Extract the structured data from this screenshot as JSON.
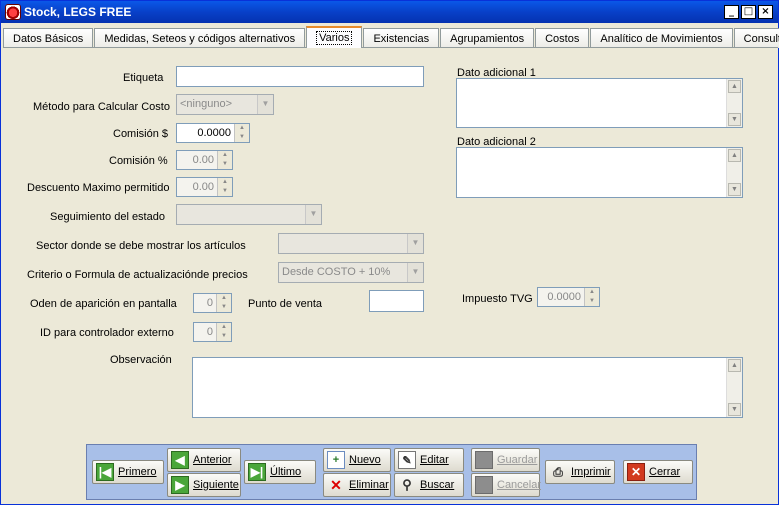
{
  "window": {
    "title": "Stock, LEGS FREE",
    "controls": {
      "minimize": "_",
      "maximize": "□",
      "close": "×"
    }
  },
  "tabs": [
    {
      "label": "Datos Básicos"
    },
    {
      "label": "Medidas, Seteos y códigos alternativos"
    },
    {
      "label": "Varios",
      "active": true
    },
    {
      "label": "Existencias"
    },
    {
      "label": "Agrupamientos"
    },
    {
      "label": "Costos"
    },
    {
      "label": "Analítico de Movimientos"
    },
    {
      "label": "Consultas"
    }
  ],
  "form": {
    "etiqueta": {
      "label": "Etiqueta",
      "value": ""
    },
    "metodo_costo": {
      "label": "Método para Calcular Costo",
      "value": "<ninguno>"
    },
    "comision_monto": {
      "label": "Comisión $",
      "value": "0.0000"
    },
    "comision_pct": {
      "label": "Comisión %",
      "value": "0.00"
    },
    "descuento_max": {
      "label": "Descuento Maximo permitido",
      "value": "0.00"
    },
    "seguimiento_estado": {
      "label": "Seguimiento del estado",
      "value": ""
    },
    "sector": {
      "label": "Sector donde se debe mostrar los artículos",
      "value": ""
    },
    "criterio": {
      "label": "Criterio o Formula de actualizaciónde precios",
      "value": "Desde COSTO + 10%"
    },
    "orden_aparicion": {
      "label": "Oden de aparición en pantalla",
      "value": "0"
    },
    "punto_venta": {
      "label": "Punto de venta",
      "value": ""
    },
    "id_controlador": {
      "label": "ID para controlador externo",
      "value": "0"
    },
    "observacion": {
      "label": "Observación",
      "value": ""
    },
    "dato_adicional_1": {
      "label": "Dato adicional 1",
      "value": ""
    },
    "dato_adicional_2": {
      "label": "Dato adicional 2",
      "value": ""
    },
    "impuesto_tvg": {
      "label": "Impuesto TVG",
      "value": "0.0000"
    }
  },
  "toolbar": {
    "primero": "Primero",
    "anterior": "Anterior",
    "siguiente": "Siguiente",
    "ultimo": "Último",
    "nuevo": "Nuevo",
    "eliminar": "Eliminar",
    "editar": "Editar",
    "buscar": "Buscar",
    "guardar": "Guardar",
    "cancelar": "Cancelar",
    "imprimir": "Imprimir",
    "cerrar": "Cerrar"
  },
  "colors": {
    "titlebar": "#0a58e8",
    "active_tab_accent": "#e68b2c",
    "navbar": "#a8bfe8",
    "window_bg": "#ece9d8"
  }
}
